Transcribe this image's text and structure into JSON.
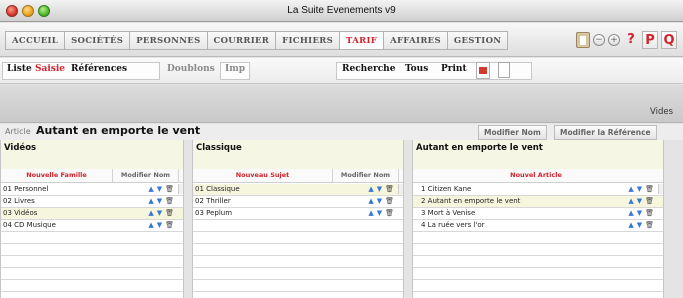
{
  "window": {
    "title": "La Suite Evenements v9",
    "traffic_colors": [
      "#ff5f57",
      "#febc2e",
      "#28c840"
    ]
  },
  "main_tabs": [
    {
      "label": "ACCUEIL",
      "active": false
    },
    {
      "label": "SOCIÉTÉS",
      "active": false
    },
    {
      "label": "PERSONNES",
      "active": false
    },
    {
      "label": "COURRIER",
      "active": false
    },
    {
      "label": "FICHIERS",
      "active": false
    },
    {
      "label": "TARIF",
      "active": true
    },
    {
      "label": "AFFAIRES",
      "active": false
    },
    {
      "label": "GESTION",
      "active": false
    }
  ],
  "tool_icons": {
    "clipboard": "clipboard-icon",
    "minus": "−",
    "plus": "+",
    "help": "?",
    "p": "P",
    "q": "Q"
  },
  "subbar": {
    "liste": "Liste",
    "saisie": "Saisie",
    "references": "Références",
    "doublons": "Doublons",
    "imp": "Imp",
    "recherche": "Recherche",
    "tous": "Tous",
    "print": "Print"
  },
  "strip": {
    "label": "Vides"
  },
  "article": {
    "label": "Article",
    "title": "Autant en emporte le vent",
    "modifier_nom": "Modifier Nom",
    "modifier_reference": "Modifier la Référence"
  },
  "panels": {
    "videos": {
      "title": "Vidéos",
      "btn_new": "Nouvelle Famille",
      "btn_modify": "Modifier Nom",
      "rows": [
        {
          "label": "01 Personnel",
          "selected": false
        },
        {
          "label": "02 Livres",
          "selected": false
        },
        {
          "label": "03 Vidéos",
          "selected": true
        },
        {
          "label": "04 CD Musique",
          "selected": false
        }
      ]
    },
    "classique": {
      "title": "Classique",
      "btn_new": "Nouveau Sujet",
      "btn_modify": "Modifier Nom",
      "rows": [
        {
          "label": "01 Classique",
          "selected": true
        },
        {
          "label": "02 Thriller",
          "selected": false
        },
        {
          "label": "03 Peplum",
          "selected": false
        }
      ]
    },
    "autant": {
      "title": "Autant en emporte le vent",
      "btn_new": "Nouvel Article",
      "rows": [
        {
          "label": "1  Citizen Kane",
          "selected": false
        },
        {
          "label": "2  Autant en emporte le vent",
          "selected": true
        },
        {
          "label": "3  Mort à Venise",
          "selected": false
        },
        {
          "label": "4  La ruée vers l'or",
          "selected": false
        }
      ]
    }
  },
  "row_controls": {
    "up": "▲",
    "down": "▼",
    "trash": "🗑"
  }
}
